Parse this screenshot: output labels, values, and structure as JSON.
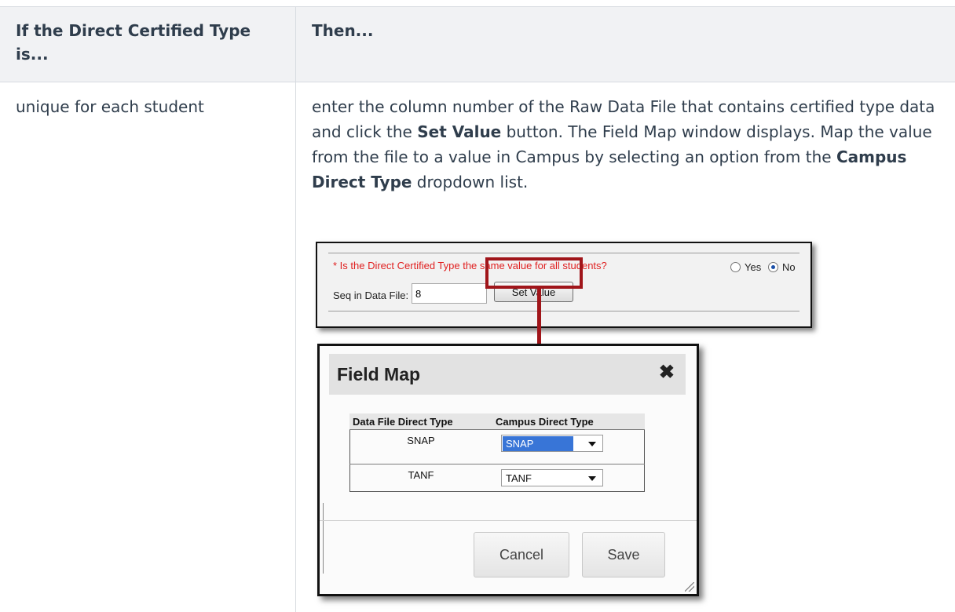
{
  "table": {
    "header_condition": "If the Direct Certified Type is...",
    "header_result": "Then...",
    "row_condition": "unique for each student",
    "row_result_part1": "enter the column number of the Raw Data File that contains certified type data and click the ",
    "row_result_bold1": "Set Value",
    "row_result_part2": " button. The Field Map window displays. Map the value from the file to a value in Campus by selecting an option from the ",
    "row_result_bold2": "Campus Direct Type",
    "row_result_part3": " dropdown list."
  },
  "form_panel": {
    "question": "* Is the Direct Certified Type the same value for all students?",
    "yes_label": "Yes",
    "no_label": "No",
    "selected": "No",
    "seq_label": "Seq in Data File:",
    "seq_value": "8",
    "set_value_button": "Set Value"
  },
  "field_map": {
    "title": "Field Map",
    "close_glyph": "✖",
    "col_data_file": "Data File Direct Type",
    "col_campus": "Campus Direct Type",
    "rows": [
      {
        "data_file_type": "SNAP",
        "campus_type": "SNAP"
      },
      {
        "data_file_type": "TANF",
        "campus_type": "TANF"
      }
    ],
    "cancel_button": "Cancel",
    "save_button": "Save"
  },
  "colors": {
    "highlight_red": "#a0151a",
    "question_red": "#e02020",
    "select_highlight": "#3875d7"
  }
}
